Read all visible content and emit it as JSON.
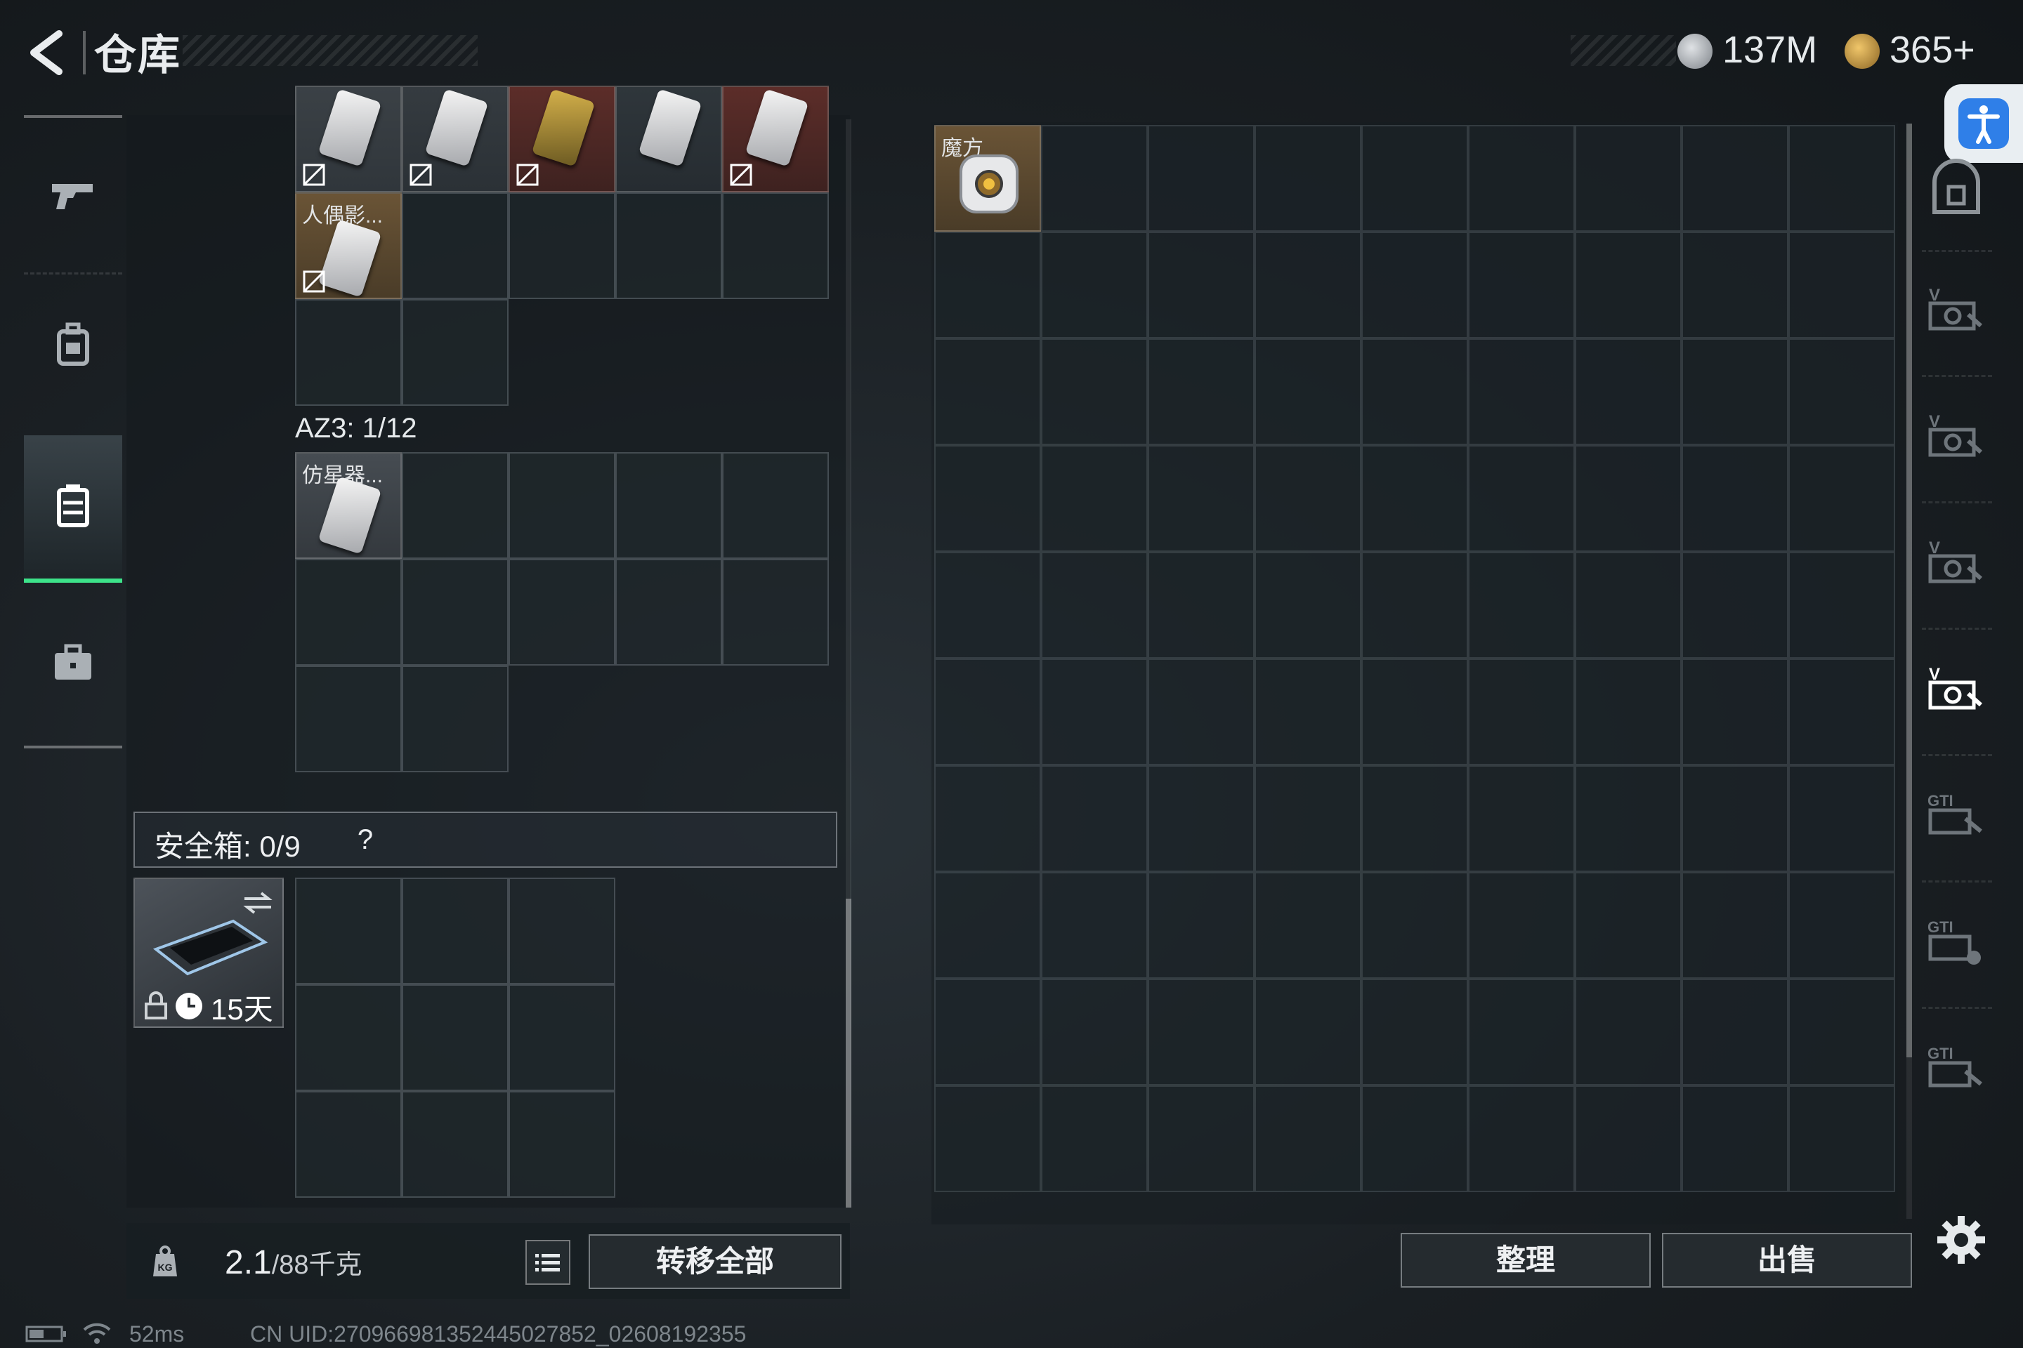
{
  "header": {
    "title": "仓库",
    "currency_silver": "137M",
    "currency_gold": "365+"
  },
  "left_nav": {
    "items": [
      {
        "icon": "pistol-icon"
      },
      {
        "icon": "backpack-icon"
      },
      {
        "icon": "container-icon",
        "active": true
      },
      {
        "icon": "briefcase-icon"
      }
    ]
  },
  "container_top": {
    "items": [
      {
        "name": "",
        "color": "#3a3f44"
      },
      {
        "name": "",
        "color": "#2f353a"
      },
      {
        "name": "",
        "color": "#5a2a26"
      },
      {
        "name": "",
        "color": "#2b3238"
      },
      {
        "name": "",
        "color": "#5a2a26"
      },
      {
        "name": "人偶影..."
      }
    ]
  },
  "az3": {
    "label": "AZ3: 1/12",
    "item_name": "仿星器..."
  },
  "safebox": {
    "label": "安全箱:  0/9",
    "help": "?",
    "days": "15天"
  },
  "bottom_left": {
    "weight": "2.1",
    "weight_cap": "/88千克",
    "transfer_all": "转移全部"
  },
  "stash": {
    "item_name": "魔方",
    "sort_label": "整理",
    "sell_label": "出售"
  },
  "right_tabs": [
    {
      "icon": "home-stash-icon"
    },
    {
      "icon": "v-case-icon"
    },
    {
      "icon": "v-case-icon"
    },
    {
      "icon": "v-case-icon"
    },
    {
      "icon": "v-case-icon-active"
    },
    {
      "icon": "gti-case-icon"
    },
    {
      "icon": "gti-case-icon"
    },
    {
      "icon": "gti-case-icon"
    }
  ],
  "status_bar": {
    "ping": "52ms",
    "uid": "CN UID:270966981352445027852_02608192355"
  },
  "colors": {
    "accent_green": "#3de38a",
    "a11y_blue": "#2f7fe8",
    "gold_item_bg": "#6a5436"
  }
}
